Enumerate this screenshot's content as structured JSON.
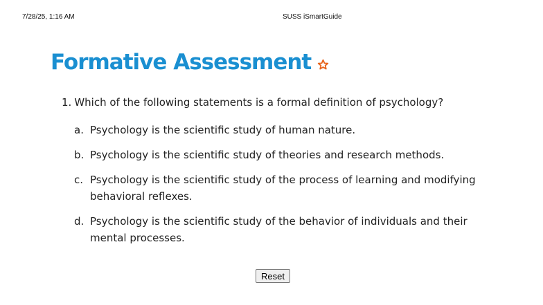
{
  "print_header": {
    "datetime": "7/28/25, 1:16 AM",
    "site_title": "SUSS iSmartGuide"
  },
  "page": {
    "title": "Formative Assessment",
    "title_color": "#1a8fd1",
    "star_icon": "star-outline-icon",
    "star_color": "#e8641c"
  },
  "question": {
    "number": "1.",
    "text": "Which of the following statements is a formal definition of psychology?",
    "options": [
      {
        "letter": "a.",
        "text": "Psychology is the scientific study of human nature."
      },
      {
        "letter": "b.",
        "text": "Psychology is the scientific study of theories and research methods."
      },
      {
        "letter": "c.",
        "text": "Psychology is the scientific study of the process of learning and modifying behavioral reflexes."
      },
      {
        "letter": "d.",
        "text": "Psychology is the scientific study of the behavior of individuals and their mental processes."
      }
    ]
  },
  "controls": {
    "reset_label": "Reset"
  }
}
